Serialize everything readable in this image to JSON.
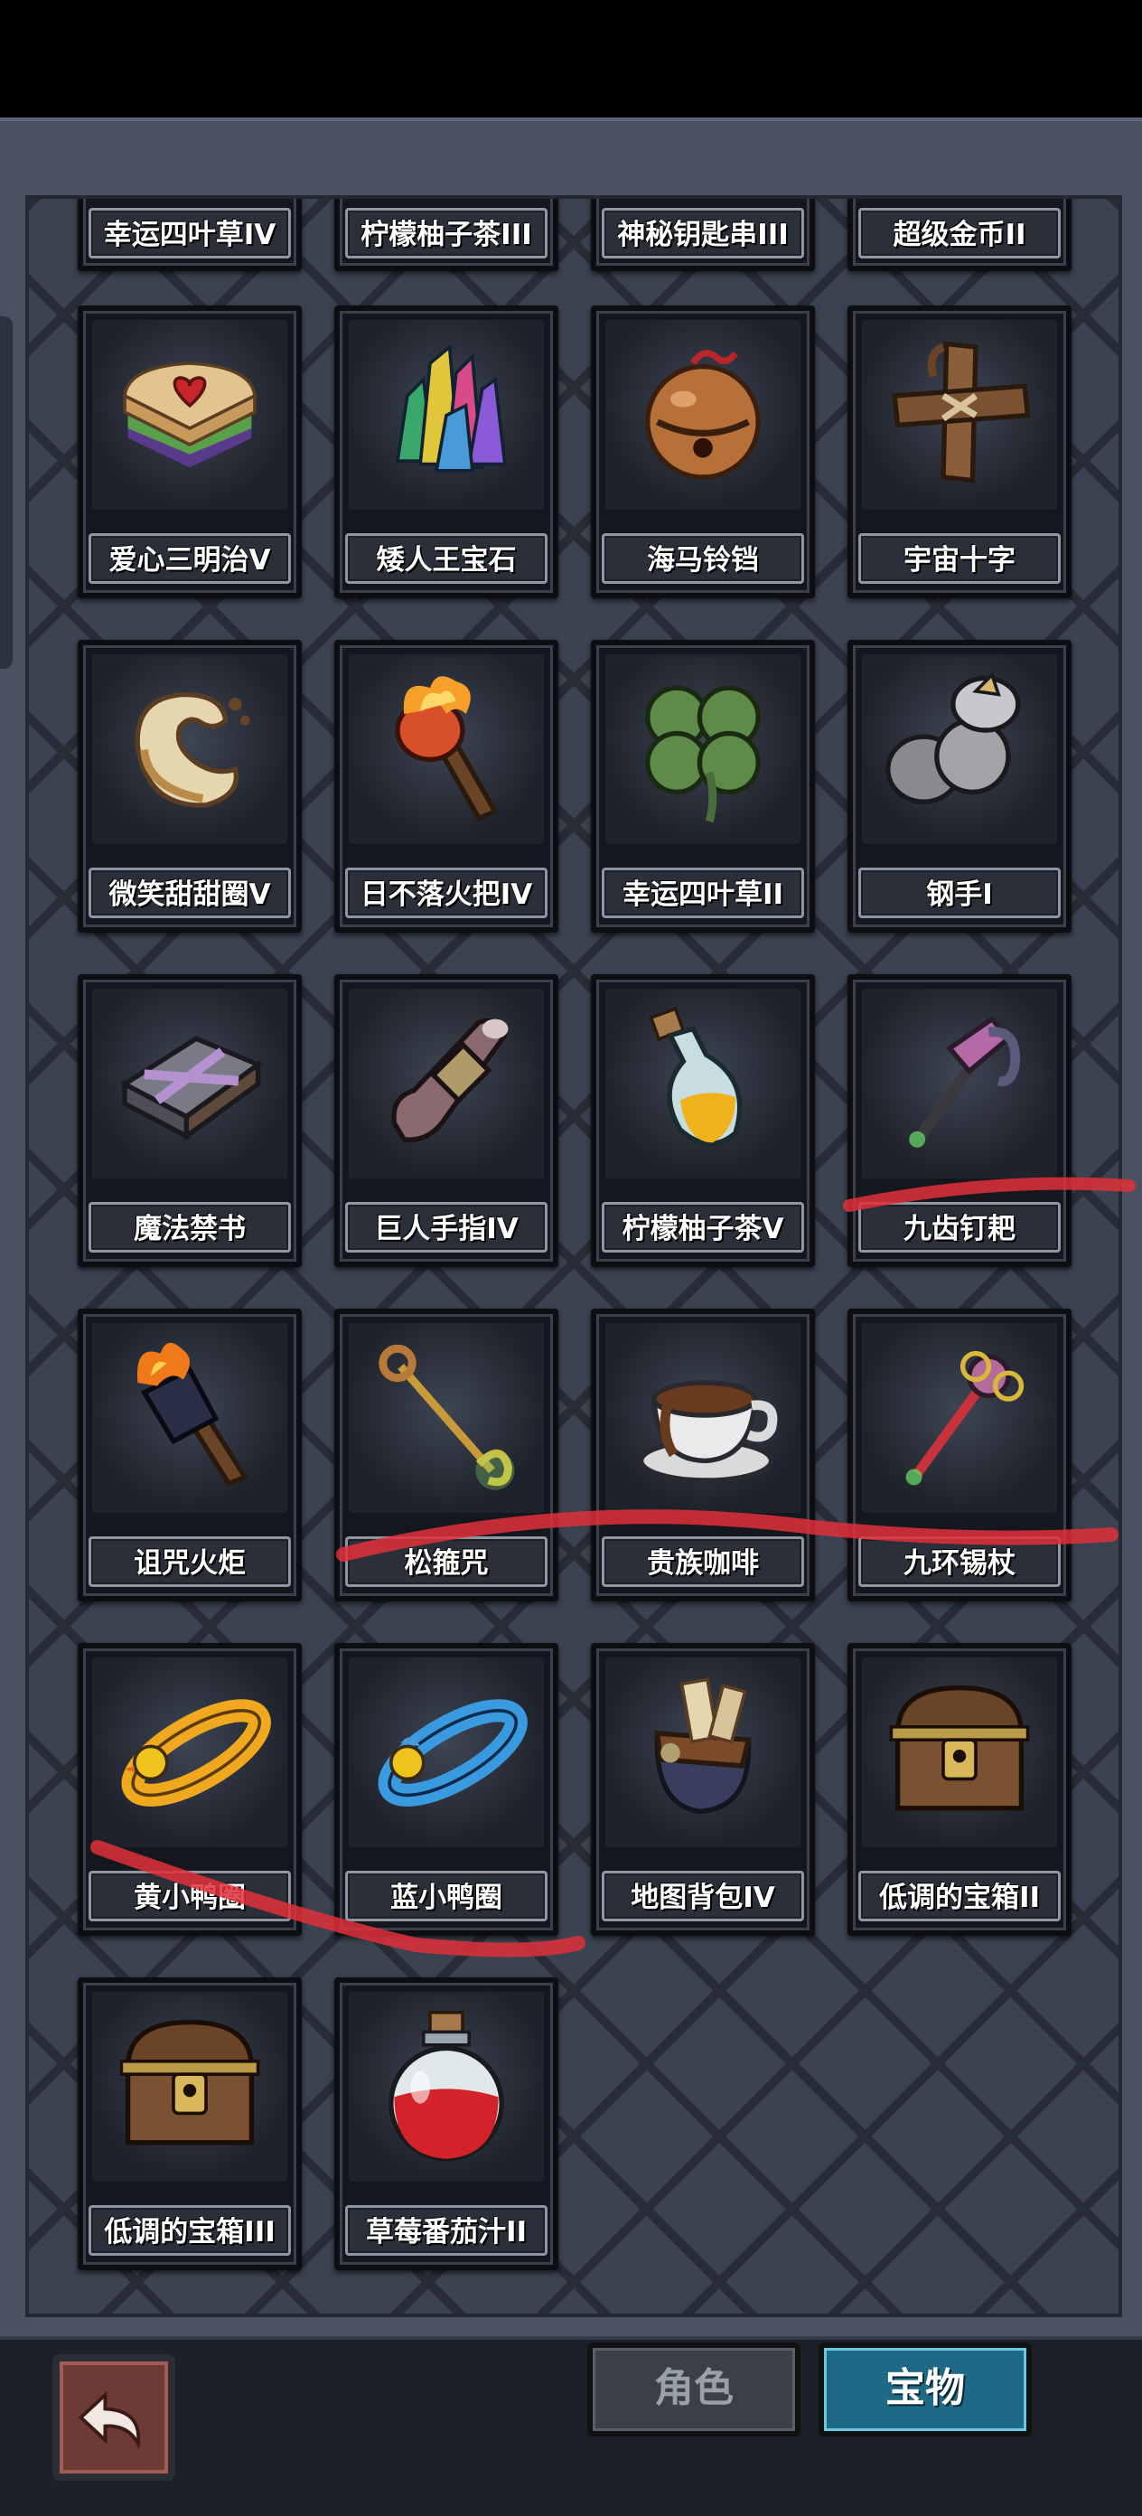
{
  "grid": {
    "top_row_cut": [
      {
        "name": "幸运四叶草IV",
        "icon": "clover-icon"
      },
      {
        "name": "柠檬柚子茶III",
        "icon": "potion-bottle-icon"
      },
      {
        "name": "神秘钥匙串III",
        "icon": "key-ring-icon"
      },
      {
        "name": "超级金币II",
        "icon": "gold-coin-icon"
      }
    ],
    "rows": [
      [
        {
          "name": "爱心三明治V",
          "icon": "heart-sandwich-icon"
        },
        {
          "name": "矮人王宝石",
          "icon": "crystal-gem-icon"
        },
        {
          "name": "海马铃铛",
          "icon": "bell-icon"
        },
        {
          "name": "宇宙十字",
          "icon": "wooden-cross-icon"
        }
      ],
      [
        {
          "name": "微笑甜甜圈V",
          "icon": "donut-icon"
        },
        {
          "name": "日不落火把IV",
          "icon": "torch-icon"
        },
        {
          "name": "幸运四叶草II",
          "icon": "clover-icon"
        },
        {
          "name": "钢手I",
          "icon": "steel-gauntlet-icon"
        }
      ],
      [
        {
          "name": "魔法禁书",
          "icon": "chained-book-icon"
        },
        {
          "name": "巨人手指IV",
          "icon": "giant-finger-icon"
        },
        {
          "name": "柠檬柚子茶V",
          "icon": "potion-bottle-icon"
        },
        {
          "name": "九齿钉耙",
          "icon": "rake-icon"
        }
      ],
      [
        {
          "name": "诅咒火炬",
          "icon": "cursed-torch-icon"
        },
        {
          "name": "松箍咒",
          "icon": "golden-staff-icon"
        },
        {
          "name": "贵族咖啡",
          "icon": "coffee-cup-icon"
        },
        {
          "name": "九环锡杖",
          "icon": "ring-staff-icon"
        }
      ],
      [
        {
          "name": "黄小鸭圈",
          "icon": "yellow-duck-ring-icon"
        },
        {
          "name": "蓝小鸭圈",
          "icon": "blue-duck-ring-icon"
        },
        {
          "name": "地图背包IV",
          "icon": "map-backpack-icon"
        },
        {
          "name": "低调的宝箱II",
          "icon": "treasure-chest-icon"
        }
      ],
      [
        {
          "name": "低调的宝箱III",
          "icon": "treasure-chest-icon"
        },
        {
          "name": "草莓番茄汁II",
          "icon": "red-potion-icon"
        }
      ]
    ]
  },
  "bottom_bar": {
    "back_icon": "back-arrow-icon",
    "tab_role": "角色",
    "tab_treasure": "宝物",
    "active_tab": "宝物"
  },
  "colors": {
    "active_tab": "#1e6a86",
    "annotation_stroke": "#e0303a"
  }
}
